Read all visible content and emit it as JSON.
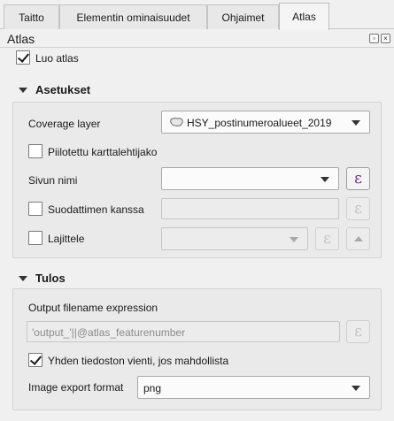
{
  "tabs": [
    {
      "label": "Taitto"
    },
    {
      "label": "Elementin ominaisuudet"
    },
    {
      "label": "Ohjaimet"
    },
    {
      "label": "Atlas"
    }
  ],
  "panel": {
    "title": "Atlas"
  },
  "generate_atlas": {
    "label": "Luo atlas",
    "checked": true
  },
  "settings": {
    "title": "Asetukset",
    "coverage_label": "Coverage layer",
    "coverage_value": "HSY_postinumeroalueet_2019",
    "hidden_label": "Piilotettu karttalehtijako",
    "page_name_label": "Sivun nimi",
    "page_name_value": "",
    "filter_label": "Suodattimen kanssa",
    "sort_label": "Lajittele",
    "expression_icon": "ε"
  },
  "output": {
    "title": "Tulos",
    "filename_label": "Output filename expression",
    "filename_value": "'output_'||@atlas_featurenumber",
    "single_file_label": "Yhden tiedoston vienti, jos mahdollista",
    "single_file_checked": true,
    "format_label": "Image export format",
    "format_value": "png"
  }
}
